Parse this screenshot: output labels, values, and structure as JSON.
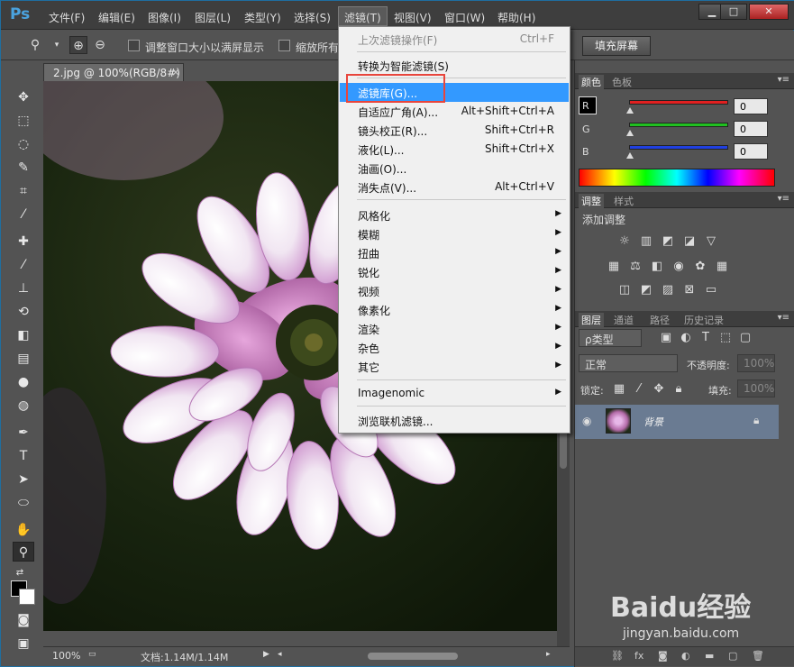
{
  "menubar": {
    "logo": "Ps",
    "items": [
      "文件(F)",
      "编辑(E)",
      "图像(I)",
      "图层(L)",
      "类型(Y)",
      "选择(S)",
      "滤镜(T)",
      "视图(V)",
      "窗口(W)",
      "帮助(H)"
    ],
    "window_buttons": [
      "▁",
      "□",
      "✕"
    ]
  },
  "options": {
    "fit_window_label": "调整窗口大小以满屏显示",
    "zoom_all_label": "缩放所有",
    "fill_screen_label": "填充屏幕"
  },
  "document": {
    "tab_label": "2.jpg @ 100%(RGB/8#)",
    "tab_close": "×",
    "zoom_status": "100%",
    "doc_status": "文档:1.14M/1.14M"
  },
  "filter_menu": {
    "items": [
      {
        "label": "上次滤镜操作(F)",
        "shortcut": "Ctrl+F",
        "disabled": true
      },
      {
        "label": "转换为智能滤镜(S)",
        "shortcut": ""
      },
      {
        "label": "滤镜库(G)...",
        "shortcut": "",
        "highlighted": true
      },
      {
        "label": "自适应广角(A)...",
        "shortcut": "Alt+Shift+Ctrl+A"
      },
      {
        "label": "镜头校正(R)...",
        "shortcut": "Shift+Ctrl+R"
      },
      {
        "label": "液化(L)...",
        "shortcut": "Shift+Ctrl+X"
      },
      {
        "label": "油画(O)...",
        "shortcut": ""
      },
      {
        "label": "消失点(V)...",
        "shortcut": "Alt+Ctrl+V"
      },
      {
        "label": "风格化",
        "submenu": true
      },
      {
        "label": "模糊",
        "submenu": true
      },
      {
        "label": "扭曲",
        "submenu": true
      },
      {
        "label": "锐化",
        "submenu": true
      },
      {
        "label": "视频",
        "submenu": true
      },
      {
        "label": "像素化",
        "submenu": true
      },
      {
        "label": "渲染",
        "submenu": true
      },
      {
        "label": "杂色",
        "submenu": true
      },
      {
        "label": "其它",
        "submenu": true
      },
      {
        "label": "Imagenomic",
        "submenu": true
      },
      {
        "label": "浏览联机滤镜...",
        "shortcut": ""
      }
    ]
  },
  "color_panel": {
    "tabs": [
      "颜色",
      "色板"
    ],
    "channels": [
      {
        "label": "R",
        "value": "0",
        "color": "#e02020"
      },
      {
        "label": "G",
        "value": "0",
        "color": "#20c020"
      },
      {
        "label": "B",
        "value": "0",
        "color": "#2040e0"
      }
    ]
  },
  "adjust_panel": {
    "tabs": [
      "调整",
      "样式"
    ],
    "title": "添加调整"
  },
  "layers_panel": {
    "tabs": [
      "图层",
      "通道",
      "路径",
      "历史记录"
    ],
    "filter_kind": "ρ类型",
    "blend_mode": "正常",
    "opacity_label": "不透明度:",
    "opacity_value": "100%",
    "lock_label": "锁定:",
    "fill_label": "填充:",
    "fill_value": "100%",
    "layer_name": "背景"
  },
  "watermark": {
    "logo": "Baidu经验",
    "sub": "jingyan.baidu.com"
  }
}
